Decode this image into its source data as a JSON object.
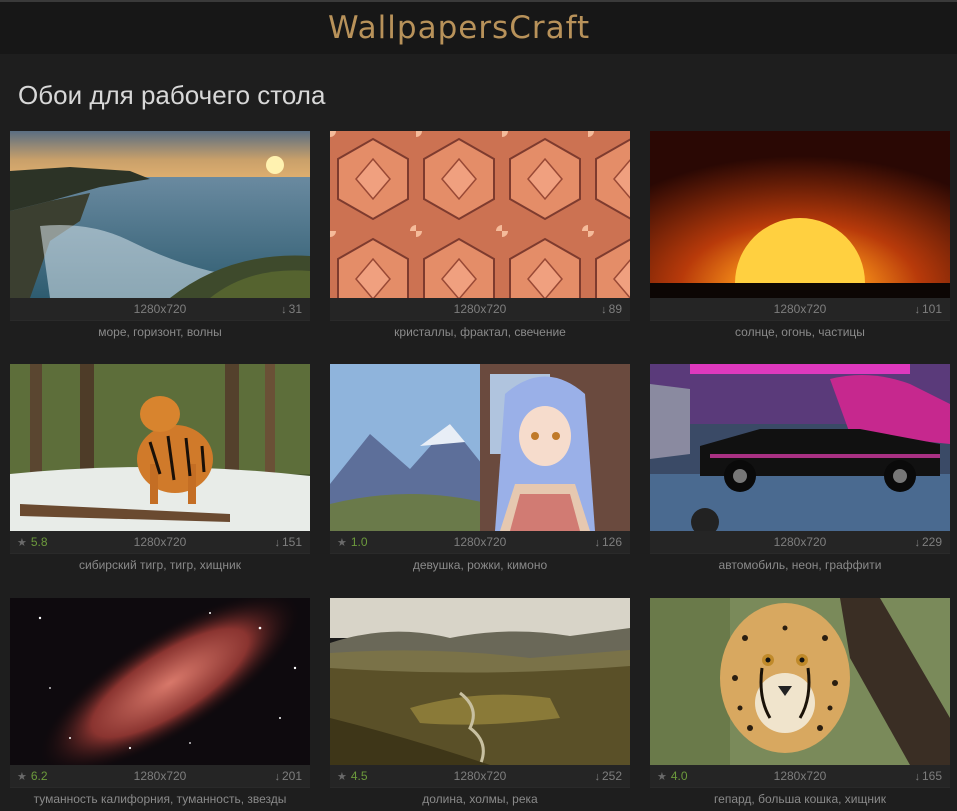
{
  "header": {
    "logo": "WallpapersCraft"
  },
  "page_title": "Обои для рабочего стола",
  "colors": {
    "background": "#1e1e1e",
    "header": "#171717",
    "logo": "#b8925a",
    "rating": "#6c9a3c"
  },
  "wallpapers": [
    {
      "resolution": "1280x720",
      "rating": "",
      "downloads": "31",
      "tags": "море, горизонт, волны"
    },
    {
      "resolution": "1280x720",
      "rating": "",
      "downloads": "89",
      "tags": "кристаллы, фрактал, свечение"
    },
    {
      "resolution": "1280x720",
      "rating": "",
      "downloads": "101",
      "tags": "солнце, огонь, частицы"
    },
    {
      "resolution": "1280x720",
      "rating": "5.8",
      "downloads": "151",
      "tags": "сибирский тигр, тигр, хищник"
    },
    {
      "resolution": "1280x720",
      "rating": "1.0",
      "downloads": "126",
      "tags": "девушка, рожки, кимоно"
    },
    {
      "resolution": "1280x720",
      "rating": "",
      "downloads": "229",
      "tags": "автомобиль, неон, граффити"
    },
    {
      "resolution": "1280x720",
      "rating": "6.2",
      "downloads": "201",
      "tags": "туманность калифорния, туманность, звезды"
    },
    {
      "resolution": "1280x720",
      "rating": "4.5",
      "downloads": "252",
      "tags": "долина, холмы, река"
    },
    {
      "resolution": "1280x720",
      "rating": "4.0",
      "downloads": "165",
      "tags": "гепард, больша кошка, хищник"
    }
  ]
}
